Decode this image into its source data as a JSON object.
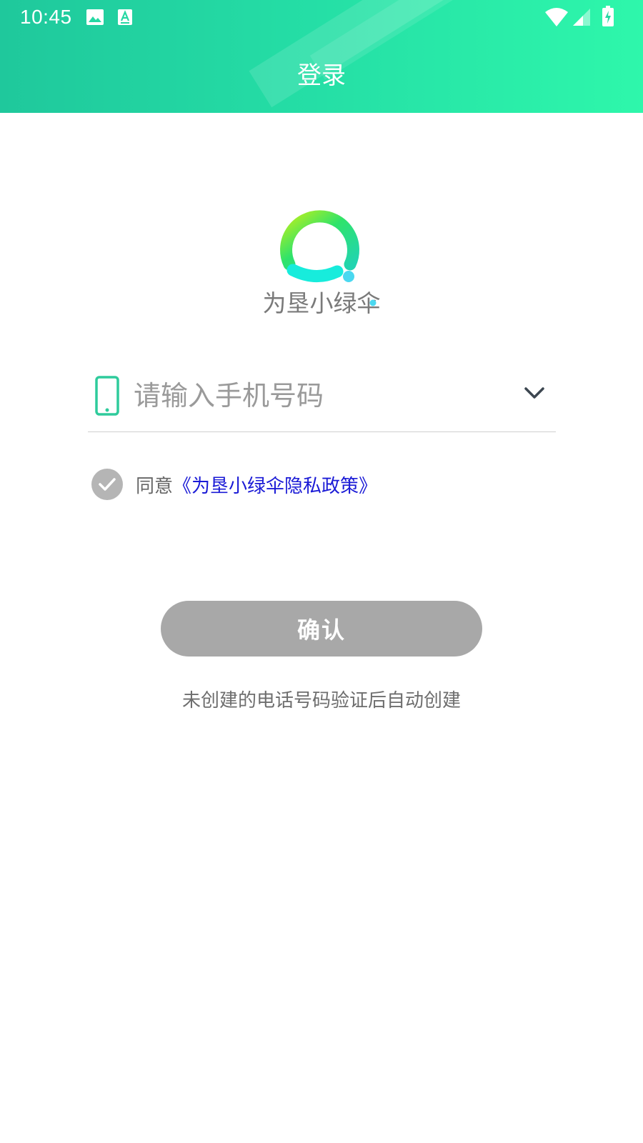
{
  "status_bar": {
    "time": "10:45",
    "left_icons": [
      "image-icon",
      "text-a-icon"
    ],
    "right_icons": [
      "wifi-icon",
      "cellular-signal-icon",
      "battery-charging-icon"
    ]
  },
  "header": {
    "title": "登录",
    "gradient_start": "#1fc89c",
    "gradient_end": "#2ef7ab"
  },
  "logo": {
    "text": "为垦小绿伞",
    "icon": "umbrella-ring-logo-icon"
  },
  "phone_field": {
    "icon": "mobile-phone-icon",
    "placeholder": "请输入手机号码",
    "value": "",
    "dropdown_icon": "chevron-down-icon"
  },
  "agreement": {
    "checked": true,
    "prefix": "同意",
    "link_text": "《为垦小绿伞隐私政策》",
    "link_color": "#1a1ad6"
  },
  "confirm": {
    "label": "确认",
    "background": "#a8a8a8"
  },
  "hint_text": "未创建的电话号码验证后自动创建"
}
